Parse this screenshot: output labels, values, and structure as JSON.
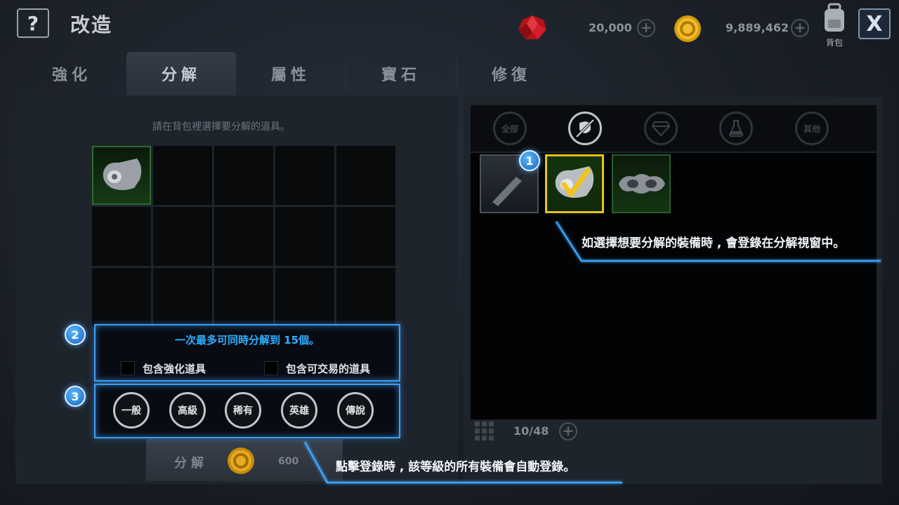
{
  "header": {
    "help_label": "?",
    "title": "改造",
    "currency_gems": "20,000",
    "currency_gold": "9,889,462",
    "bag_label": "背包",
    "close_label": "X",
    "plus_label": "+"
  },
  "tabs": [
    {
      "label": "強化",
      "active": false
    },
    {
      "label": "分解",
      "active": true
    },
    {
      "label": "屬性",
      "active": false
    },
    {
      "label": "寶石",
      "active": false
    },
    {
      "label": "修復",
      "active": false
    }
  ],
  "left_panel": {
    "hint": "請在背包裡選擇要分解的道具。",
    "limit_text": "一次最多可同時分解到 15個。",
    "checkbox_enhanced": "包含強化道具",
    "checkbox_tradeable": "包含可交易的道具",
    "grades": [
      "一般",
      "高級",
      "稀有",
      "英雄",
      "傳說"
    ],
    "decompose_label": "分解",
    "decompose_cost": "600"
  },
  "right_panel": {
    "filters": [
      {
        "label": "全部",
        "icon": "all-icon",
        "active": false
      },
      {
        "label": "",
        "icon": "armor-icon",
        "active": true
      },
      {
        "label": "",
        "icon": "gem-icon",
        "active": false
      },
      {
        "label": "",
        "icon": "potion-icon",
        "active": false
      },
      {
        "label": "其他",
        "icon": "other-icon",
        "active": false
      }
    ],
    "inventory_count": "10/48"
  },
  "tutorial": {
    "markers": [
      "1",
      "2",
      "3"
    ],
    "callout_1": "如選擇想要分解的裝備時 , 會登錄在分解視窗中。",
    "callout_2": "點擊登錄時 , 該等級的所有裝備會自動登錄。"
  },
  "colors": {
    "highlight": "#3b9ff2",
    "selected_border": "#e7c21c",
    "uncommon_border": "#2d6b2d",
    "limit_text": "#2fb0ff"
  }
}
